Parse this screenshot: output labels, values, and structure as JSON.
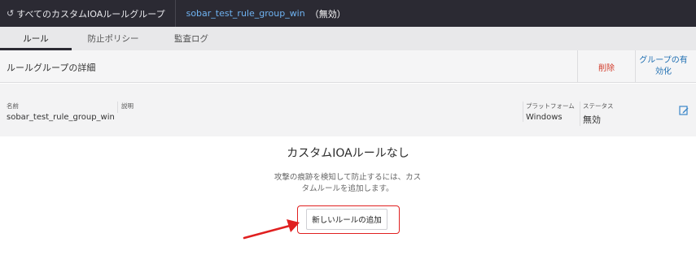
{
  "topbar": {
    "back_label": "すべてのカスタムIOAルールグループ",
    "back_icon": "undo-arrow-icon",
    "group_name": "sobar_test_rule_group_win",
    "group_status": "（無効）"
  },
  "tabs": [
    {
      "label": "ルール",
      "active": true
    },
    {
      "label": "防止ポリシー",
      "active": false
    },
    {
      "label": "監査ログ",
      "active": false
    }
  ],
  "section": {
    "title": "ルールグループの詳細",
    "delete_label": "削除",
    "enable_label": "グループの有効化"
  },
  "details": {
    "name_label": "名前",
    "name_value": "sobar_test_rule_group_win",
    "desc_label": "説明",
    "desc_value": "",
    "platform_label": "プラットフォーム",
    "platform_value": "Windows",
    "status_label": "ステータス",
    "status_value": "無効",
    "edit_icon": "edit-icon"
  },
  "empty_state": {
    "title": "カスタムIOAルールなし",
    "description": "攻撃の痕跡を検知して防止するには、カスタムルールを追加します。",
    "add_button_label": "新しいルールの追加"
  },
  "colors": {
    "topbar_bg": "#2b2a33",
    "link": "#6fb3f2",
    "delete": "#d23b2a",
    "enable": "#1f6fb2",
    "annotation": "#e02020"
  }
}
